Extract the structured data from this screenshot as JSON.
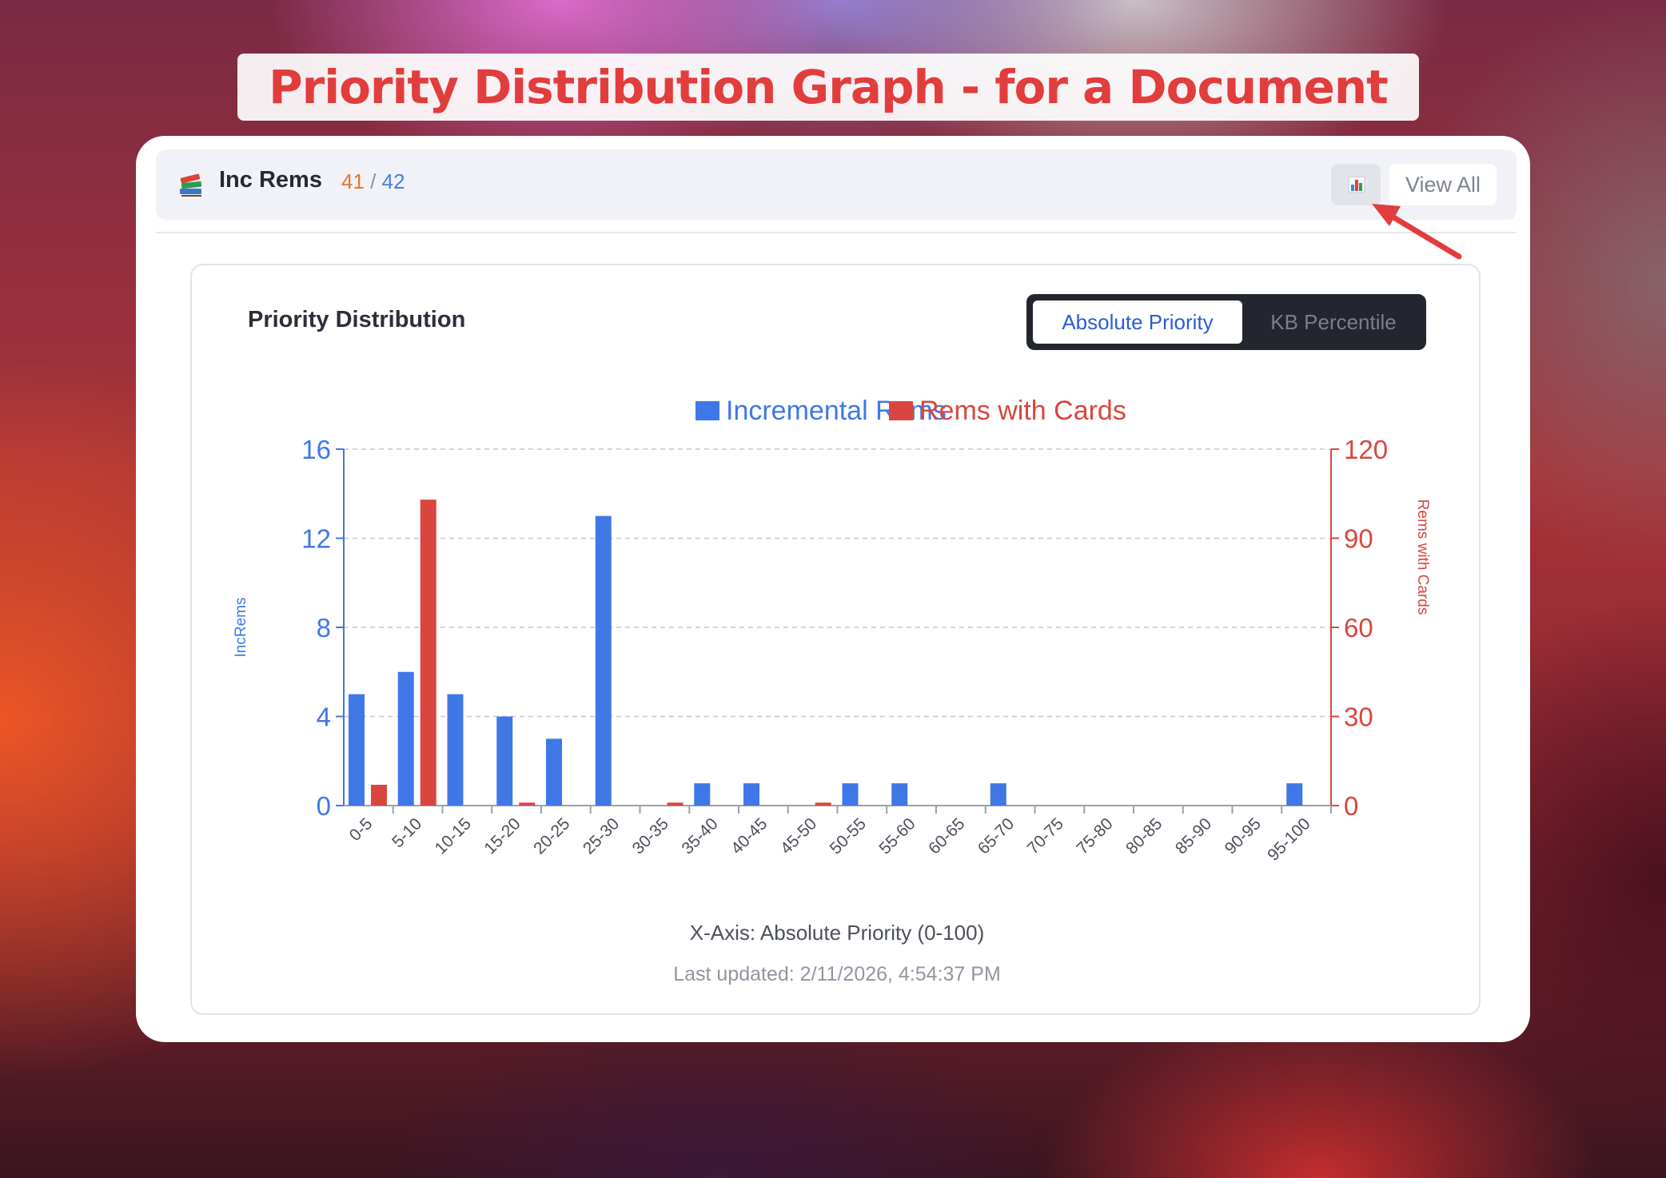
{
  "headline": "Priority Distribution Graph - for a Document",
  "toolbar": {
    "icon": "books-icon",
    "title": "Inc Rems",
    "count_done": "41",
    "count_sep": "/",
    "count_total": "42",
    "chart_button_icon": "bar-chart-icon",
    "view_all_label": "View All"
  },
  "card": {
    "title": "Priority Distribution",
    "toggle": {
      "active": "Absolute Priority",
      "inactive": "KB Percentile"
    },
    "x_axis_note": "X-Axis: Absolute Priority (0-100)",
    "last_updated": "Last updated: 2/11/2026, 4:54:37 PM"
  },
  "colors": {
    "incremental": "#3f78e6",
    "cards": "#d9463f",
    "annotation": "#e23d3d"
  },
  "chart_data": {
    "type": "bar",
    "categories": [
      "0-5",
      "5-10",
      "10-15",
      "15-20",
      "20-25",
      "25-30",
      "30-35",
      "35-40",
      "40-45",
      "45-50",
      "50-55",
      "55-60",
      "60-65",
      "65-70",
      "70-75",
      "75-80",
      "80-85",
      "85-90",
      "90-95",
      "95-100"
    ],
    "series": [
      {
        "name": "Incremental Rems",
        "axis": "left",
        "values": [
          5,
          6,
          5,
          4,
          3,
          13,
          0,
          1,
          1,
          0,
          1,
          1,
          0,
          1,
          0,
          0,
          0,
          0,
          0,
          1
        ]
      },
      {
        "name": "Rems with Cards",
        "axis": "right",
        "values": [
          7,
          103,
          0,
          1,
          0,
          0,
          1,
          0,
          0,
          1,
          0,
          0,
          0,
          0,
          0,
          0,
          0,
          0,
          0,
          0
        ]
      }
    ],
    "ylabel_left": "IncRems",
    "ylabel_right": "Rems with Cards",
    "ylim_left": [
      0,
      16
    ],
    "ylim_right": [
      0,
      120
    ],
    "yticks_left": [
      "0",
      "4",
      "8",
      "12",
      "16"
    ],
    "yticks_right": [
      "0",
      "30",
      "60",
      "90",
      "120"
    ],
    "legend_placement": "top-center",
    "grid": true
  }
}
